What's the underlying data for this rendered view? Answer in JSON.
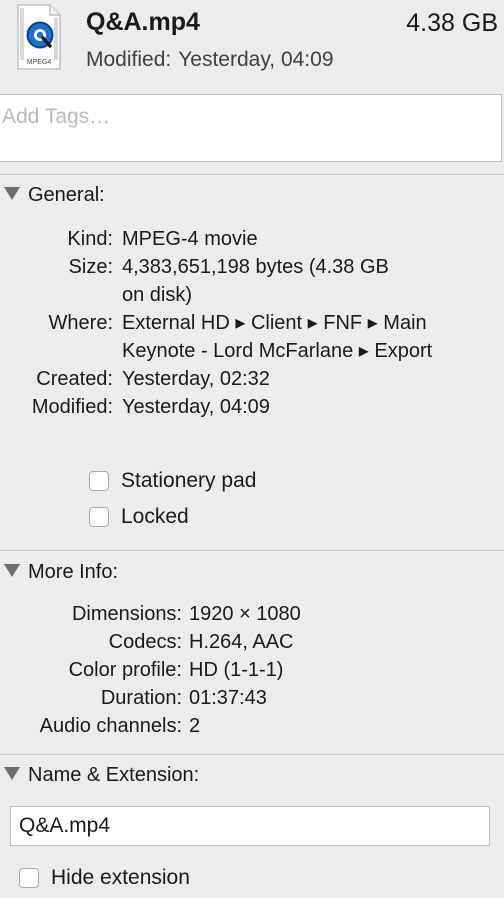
{
  "header": {
    "file_name": "Q&A.mp4",
    "file_size": "4.38 GB",
    "modified_label": "Modified:",
    "modified_value": "Yesterday, 04:09",
    "icon_label": "MPEG4"
  },
  "tags": {
    "placeholder": "Add Tags…"
  },
  "general": {
    "title": "General:",
    "fields": [
      {
        "label": "Kind:",
        "lines": [
          "MPEG-4 movie"
        ]
      },
      {
        "label": "Size:",
        "lines": [
          "4,383,651,198 bytes (4.38 GB",
          "on disk)"
        ]
      },
      {
        "label": "Where:",
        "lines": [
          "External HD ▸ Client ▸ FNF ▸ Main",
          "Keynote - Lord McFarlane ▸ Export"
        ]
      },
      {
        "label": "Created:",
        "lines": [
          "Yesterday, 02:32"
        ]
      },
      {
        "label": "Modified:",
        "lines": [
          "Yesterday, 04:09"
        ]
      }
    ],
    "stationery_label": "Stationery pad",
    "locked_label": "Locked"
  },
  "more_info": {
    "title": "More Info:",
    "fields": [
      {
        "label": "Dimensions:",
        "value": "1920 × 1080"
      },
      {
        "label": "Codecs:",
        "value": "H.264, AAC"
      },
      {
        "label": "Color profile:",
        "value": "HD (1-1-1)"
      },
      {
        "label": "Duration:",
        "value": "01:37:43"
      },
      {
        "label": "Audio channels:",
        "value": "2"
      }
    ]
  },
  "name_extension": {
    "title": "Name & Extension:",
    "name_value": "Q&A.mp4",
    "hide_extension_label": "Hide extension"
  },
  "colors": {
    "background": "#ececec",
    "quicktime_blue": "#1f6fd1"
  },
  "icons": [
    "mpeg4-file-icon",
    "disclosure-triangle-icon"
  ]
}
